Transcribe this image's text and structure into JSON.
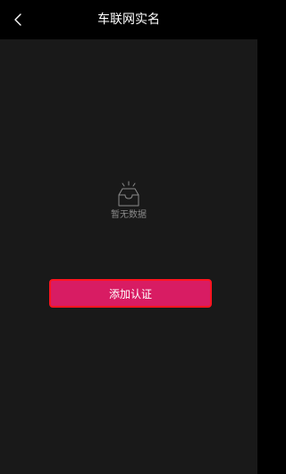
{
  "header": {
    "title": "车联网实名",
    "back_icon": "chevron-left-icon"
  },
  "empty_state": {
    "icon": "empty-tray-icon",
    "text": "暂无数据"
  },
  "actions": {
    "add_label": "添加认证"
  },
  "colors": {
    "header_bg": "#000000",
    "page_bg": "#191919",
    "button_bg": "#d81c63",
    "button_border": "#ff1420",
    "muted_text": "#8a8a8a"
  }
}
